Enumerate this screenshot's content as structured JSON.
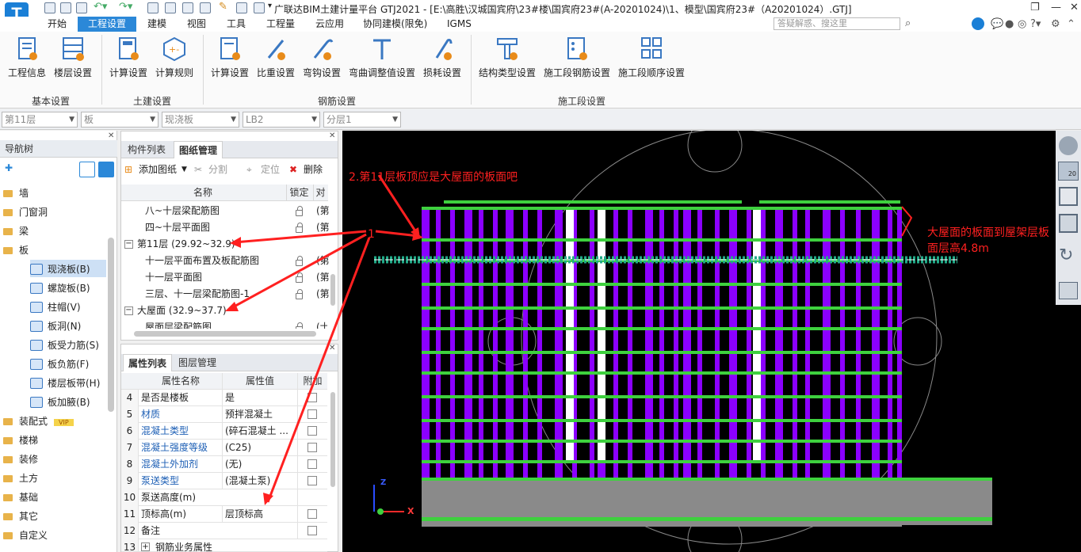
{
  "app": {
    "title": "广联达BIM土建计量平台 GTJ2021 - [E:\\高胜\\汉城国宾府\\23#楼\\国宾府23#(A-20201024)\\1、模型\\国宾府23#（A20201024）.GTJ]",
    "logo_letter": "T",
    "search_placeholder": "答疑解惑、搜这里"
  },
  "menu": [
    "开始",
    "工程设置",
    "建模",
    "视图",
    "工具",
    "工程量",
    "云应用",
    "协同建模(限免)",
    "IGMS"
  ],
  "ribbon": {
    "buttons": [
      "工程信息",
      "楼层设置",
      "计算设置",
      "计算规则",
      "计算设置",
      "比重设置",
      "弯钩设置",
      "弯曲调整值设置",
      "损耗设置",
      "结构类型设置",
      "施工段钢筋设置",
      "施工段顺序设置"
    ],
    "groups": [
      "基本设置",
      "土建设置",
      "钢筋设置",
      "施工段设置"
    ]
  },
  "filters": [
    "第11层",
    "板",
    "现浇板",
    "LB2",
    "分层1"
  ],
  "nav": {
    "title": "导航树",
    "items": [
      "墙",
      "门窗洞",
      "梁",
      "板",
      "现浇板(B)",
      "螺旋板(B)",
      "柱帽(V)",
      "板洞(N)",
      "板受力筋(S)",
      "板负筋(F)",
      "楼层板带(H)",
      "板加腋(B)",
      "装配式",
      "楼梯",
      "装修",
      "土方",
      "基础",
      "其它",
      "自定义"
    ],
    "vip": "VIP"
  },
  "drawings": {
    "tabs": [
      "构件列表",
      "图纸管理"
    ],
    "toolbar": [
      "添加图纸",
      "分割",
      "定位",
      "删除"
    ],
    "headers": [
      "名称",
      "锁定",
      "对"
    ],
    "rows": [
      {
        "name": "八~十层梁配筋图",
        "lock": true,
        "extra": "(第"
      },
      {
        "name": "四~十层平面图",
        "lock": true,
        "extra": "(第"
      },
      {
        "name": "第11层 (29.92~32.9)",
        "group": true
      },
      {
        "name": "十一层平面布置及板配筋图",
        "lock": true,
        "extra": "(第"
      },
      {
        "name": "十一层平面图",
        "lock": true,
        "extra": "(第"
      },
      {
        "name": "三层、十一层梁配筋图-1",
        "lock": true,
        "extra": "(第"
      },
      {
        "name": "大屋面 (32.9~37.7)",
        "group": true
      },
      {
        "name": "屋面层梁配筋图",
        "lock": true,
        "extra": "(士"
      }
    ]
  },
  "props": {
    "tabs": [
      "属性列表",
      "图层管理"
    ],
    "headers": [
      "属性名称",
      "属性值",
      "附加"
    ],
    "rows": [
      {
        "n": "4",
        "k": "是否是楼板",
        "v": "是",
        "blue": false
      },
      {
        "n": "5",
        "k": "材质",
        "v": "预拌混凝土",
        "blue": true
      },
      {
        "n": "6",
        "k": "混凝土类型",
        "v": "(碎石混凝土 ...",
        "blue": true
      },
      {
        "n": "7",
        "k": "混凝土强度等级",
        "v": "(C25)",
        "blue": true
      },
      {
        "n": "8",
        "k": "混凝土外加剂",
        "v": "(无)",
        "blue": true
      },
      {
        "n": "9",
        "k": "泵送类型",
        "v": "(混凝土泵)",
        "blue": true
      },
      {
        "n": "10",
        "k": "泵送高度(m)",
        "v": "",
        "blue": false
      },
      {
        "n": "11",
        "k": "顶标高(m)",
        "v": "层顶标高",
        "blue": false
      },
      {
        "n": "12",
        "k": "备注",
        "v": "",
        "blue": false
      },
      {
        "n": "13",
        "k": "钢筋业务属性",
        "v": "",
        "blue": false
      }
    ]
  },
  "annotations": {
    "a1": "2.第11层板顶应是大屋面的板面吧",
    "a2": "大屋面的板面到屋架层板",
    "a3": "面层高4.8m",
    "a4": "1"
  },
  "axis": {
    "z": "Z",
    "x": "X"
  },
  "view_box_label": "20",
  "colors": {
    "accent": "#2b88d8",
    "purple": "#8b00ff",
    "green": "#3ed13e",
    "annotation": "#ff2020"
  }
}
